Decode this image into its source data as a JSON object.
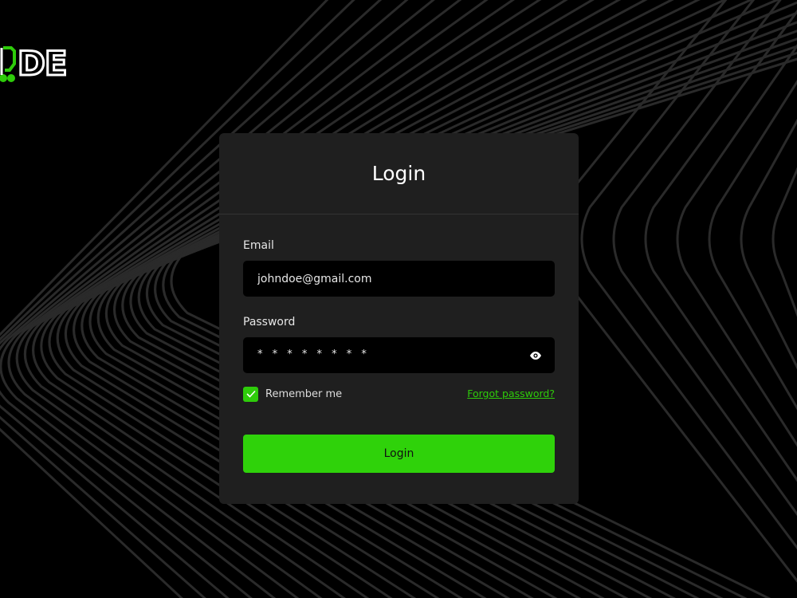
{
  "brand": {
    "logo_text": "DE",
    "accent_color": "#2ecc0a",
    "icon": "scooter-logo-icon"
  },
  "login_card": {
    "title": "Login",
    "email": {
      "label": "Email",
      "value": "johndoe@gmail.com"
    },
    "password": {
      "label": "Password",
      "masked_value": "* * * * * * * *",
      "visibility_icon": "eye-icon"
    },
    "remember_me": {
      "label": "Remember me",
      "checked": true
    },
    "forgot_password_label": "Forgot password?",
    "submit_label": "Login"
  },
  "colors": {
    "background": "#000000",
    "card": "#1f1f1f",
    "input": "#000000",
    "button": "#2fd20a"
  }
}
